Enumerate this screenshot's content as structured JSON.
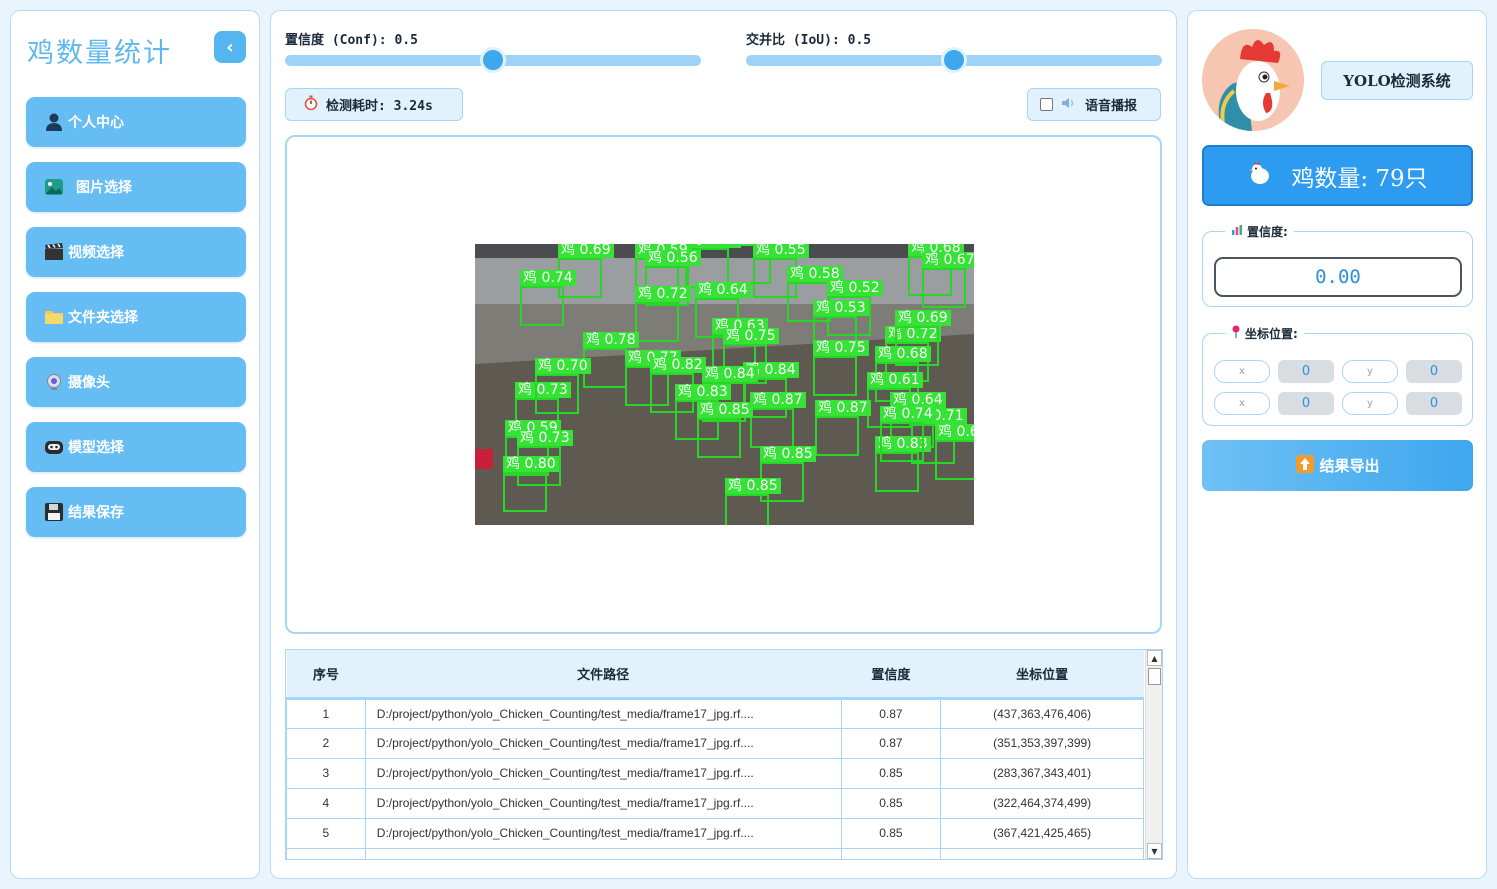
{
  "sidebar": {
    "title": "鸡数量统计",
    "collapse_icon": "‹",
    "items": [
      {
        "label": "个人中心",
        "icon": "user-icon"
      },
      {
        "label": "图片选择",
        "icon": "image-icon"
      },
      {
        "label": "视频选择",
        "icon": "clapper-icon"
      },
      {
        "label": "文件夹选择",
        "icon": "folder-icon"
      },
      {
        "label": "摄像头",
        "icon": "webcam-icon"
      },
      {
        "label": "模型选择",
        "icon": "robot-icon"
      },
      {
        "label": "结果保存",
        "icon": "floppy-disk-icon"
      }
    ]
  },
  "controls": {
    "conf_label": "置信度 (Conf): 0.5",
    "conf_value": 0.5,
    "iou_label": "交并比 (IoU): 0.5",
    "iou_value": 0.5,
    "time_label": "检测耗时: 3.24s",
    "voice_label": "语音播报",
    "voice_checked": false
  },
  "detections": [
    "鸡 0.69",
    "鸡 0.73",
    "鸡 0.64",
    "鸡 0.59",
    "鸡 0.56",
    "鸡 0.55",
    "鸡 0.68",
    "鸡 0.74",
    "鸡 0.58",
    "鸡 0.52",
    "鸡 0.67",
    "鸡 0.72",
    "鸡 0.64",
    "鸡 0.53",
    "鸡 0.69",
    "鸡 0.63",
    "鸡 0.75",
    "鸡 0.72",
    "鸡 0.78",
    "鸡 0.84",
    "鸡 0.75",
    "鸡 0.68",
    "鸡 0.77",
    "鸡 0.82",
    "鸡 0.84",
    "鸡 0.61",
    "鸡 0.73",
    "鸡 0.83",
    "鸡 0.87",
    "鸡 0.87",
    "鸡 0.64",
    "鸡 0.85",
    "鸡 0.71",
    "鸡 0.59",
    "鸡 0.73",
    "鸡 0.83",
    "鸡 0.80",
    "鸡 0.85",
    "鸡 0.85",
    "鸡 0.70",
    "鸡 0.74",
    "鸡 0.6"
  ],
  "table": {
    "headers": [
      "序号",
      "文件路径",
      "置信度",
      "坐标位置"
    ],
    "rows": [
      [
        "1",
        "D:/project/python/yolo_Chicken_Counting/test_media/frame17_jpg.rf....",
        "0.87",
        "(437,363,476,406)"
      ],
      [
        "2",
        "D:/project/python/yolo_Chicken_Counting/test_media/frame17_jpg.rf....",
        "0.87",
        "(351,353,397,399)"
      ],
      [
        "3",
        "D:/project/python/yolo_Chicken_Counting/test_media/frame17_jpg.rf....",
        "0.85",
        "(283,367,343,401)"
      ],
      [
        "4",
        "D:/project/python/yolo_Chicken_Counting/test_media/frame17_jpg.rf....",
        "0.85",
        "(322,464,374,499)"
      ],
      [
        "5",
        "D:/project/python/yolo_Chicken_Counting/test_media/frame17_jpg.rf....",
        "0.85",
        "(367,421,425,465)"
      ]
    ]
  },
  "right": {
    "system_title": "YOLO检测系统",
    "count_label": "鸡数量: 79只",
    "conf_group_title": "置信度:",
    "conf_display": "0.00",
    "coord_group_title": "坐标位置:",
    "coord_labels": [
      "x",
      "y",
      "x",
      "y"
    ],
    "coord_values": [
      "0",
      "0",
      "0",
      "0"
    ],
    "export_label": "结果导出"
  },
  "colors": {
    "accent": "#66bdf4",
    "accent_dark": "#2d9cf0",
    "detect_green": "#35e235",
    "panel_border": "#b7dcf5"
  }
}
